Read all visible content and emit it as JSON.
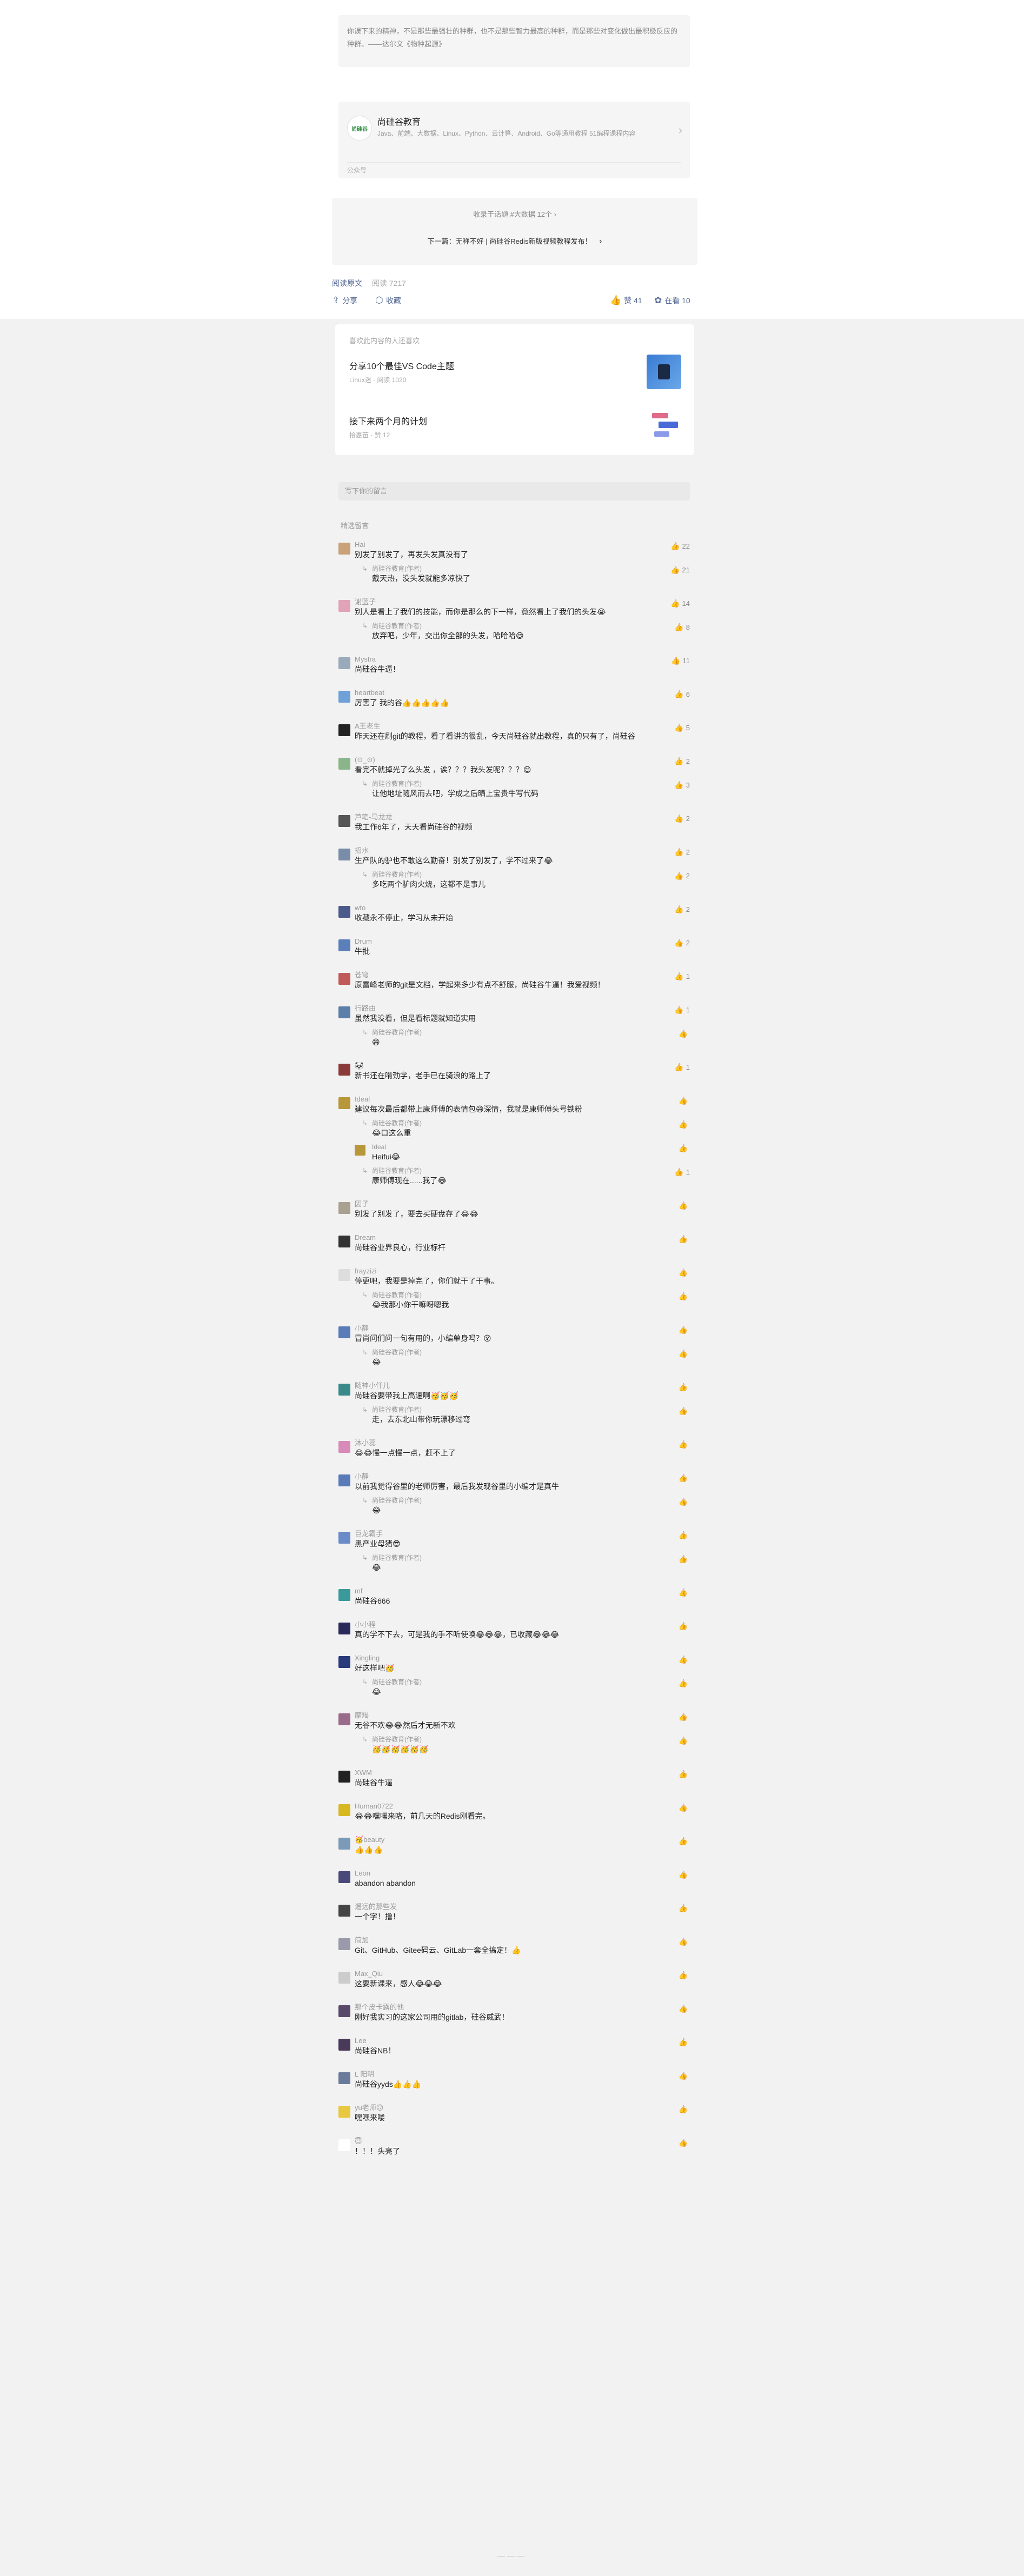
{
  "quote": "你误下来的精神，不是那些最强壮的种群，也不是那些智力最高的种群，而是那些对变化做出最积极反应的种群。——达尔文《物种起源》",
  "account": {
    "logo_text": "尚硅谷",
    "name": "尚硅谷教育",
    "desc": "Java、前端、大数据、Linux、Python、云计算、Android、Go等通用教程 51编程课程内容",
    "type": "公众号"
  },
  "album": {
    "title": "收录于话题 #大数据 12个 ›",
    "next_label": "下一篇",
    "next_title": "：无称不好 | 尚硅谷Redis新版视频教程发布！",
    "next_arrow": "›"
  },
  "meta": {
    "read_original": "阅读原文",
    "read_count": "阅读 7217"
  },
  "actions": {
    "share": "分享",
    "favorite": "收藏",
    "like": "赞 41",
    "watching": "在看 10"
  },
  "related": {
    "title": "喜欢此内容的人还喜欢",
    "items": [
      {
        "title": "分享10个最佳VS Code主题",
        "meta": "Linux迷 · 阅读 1020"
      },
      {
        "title": "接下来两个月的计划",
        "meta": "拾惠苗 · 赞 12"
      }
    ]
  },
  "write_comment": "写下你的留言",
  "featured_title": "精选留言",
  "comments": [
    {
      "name": "Hai",
      "text": "别发了别发了，再发头发真没有了",
      "likes": "22",
      "avatar": "#c9a27a",
      "replies": [
        {
          "name": "尚硅谷教育(作者)",
          "text": "戴天热，没头发就能多凉快了",
          "likes": "21"
        }
      ]
    },
    {
      "name": "谢蓝子",
      "text": "别人是看上了我们的技能，而你是那么的下一样，竟然看上了我们的头发😭",
      "likes": "14",
      "avatar": "#e0a3b8",
      "liked": true,
      "replies": [
        {
          "name": "尚硅谷教育(作者)",
          "text": "放弃吧，少年，交出你全部的头发，哈哈哈😄",
          "likes": "8"
        }
      ]
    },
    {
      "name": "Mystra",
      "text": "尚硅谷牛逼！",
      "likes": "11",
      "avatar": "#9ab",
      "replies": []
    },
    {
      "name": "heartbeat",
      "text": "厉害了 我的谷👍👍👍👍👍",
      "likes": "6",
      "avatar": "#6fa0d8",
      "replies": []
    },
    {
      "name": "A王老生",
      "text": "昨天还在刷git的教程，看了看讲的很乱，今天尚硅谷就出教程，真的只有了，尚硅谷",
      "likes": "5",
      "avatar": "#222",
      "replies": []
    },
    {
      "name": "(⊙_⊙)",
      "text": "看完不就掉光了么头发 ，诶？？？我头发呢？？？😄",
      "likes": "2",
      "avatar": "#8ab58a",
      "replies": [
        {
          "name": "尚硅谷教育(作者)",
          "text": "让他地址随风而去吧，学成之后晒上宝贵牛写代码",
          "likes": "3"
        }
      ]
    },
    {
      "name": "芦笔-马龙龙",
      "text": "我工作6年了，天天看尚硅谷的视频",
      "likes": "2",
      "avatar": "#555",
      "liked": true,
      "replies": []
    },
    {
      "name": "招水",
      "text": "生产队的驴也不敢这么勤奋！别发了别发了，学不过来了😂",
      "likes": "2",
      "avatar": "#7a8da8",
      "replies": [
        {
          "name": "尚硅谷教育(作者)",
          "text": "多吃两个驴肉火烧，这都不是事儿",
          "likes": "2"
        }
      ]
    },
    {
      "name": "wto",
      "text": "收藏永不停止，学习从未开始",
      "likes": "2",
      "avatar": "#4a5a8a",
      "replies": []
    },
    {
      "name": "Drum",
      "text": "牛批",
      "likes": "2",
      "avatar": "#5b7fb8",
      "replies": []
    },
    {
      "name": "苍穹",
      "text": "原雷峰老师的git是文档，学起来多少有点不舒服，尚硅谷牛逼！我爱视频！",
      "likes": "1",
      "avatar": "#c05a5a",
      "replies": []
    },
    {
      "name": "行路由",
      "text": "虽然我没看，但是看标题就知道实用",
      "likes": "1",
      "avatar": "#5c7ea8",
      "replies": [
        {
          "name": "尚硅谷教育(作者)",
          "text": "😄",
          "likes": ""
        }
      ]
    },
    {
      "name": "🐼",
      "text": "新书还在啃劲学，老手已在骑浪的路上了",
      "likes": "1",
      "avatar": "#8a3a3a",
      "replies": []
    },
    {
      "name": "Ideal",
      "text": "建议每次最后都带上康师傅的表情包😄深情，我就是康师傅头号铁粉",
      "likes": "",
      "avatar": "#b8963a",
      "replies": [
        {
          "name": "尚硅谷教育(作者)",
          "text": "😂口这么重",
          "likes": ""
        },
        {
          "name": "Ideal",
          "text": "Heifui😂",
          "likes": ""
        },
        {
          "name": "尚硅谷教育(作者)",
          "text": "康师傅现在......我了😂",
          "likes": "1"
        }
      ]
    },
    {
      "name": "因子",
      "text": "别发了别发了，要去买硬盘存了😂😂",
      "likes": "",
      "avatar": "#a8a090",
      "replies": []
    },
    {
      "name": "Dream",
      "text": "尚硅谷业界良心，行业标杆",
      "likes": "",
      "avatar": "#333",
      "replies": []
    },
    {
      "name": "frayzizi",
      "text": "停更吧，我要是掉完了，你们就干了干事。",
      "likes": "",
      "avatar": "#ddd",
      "replies": [
        {
          "name": "尚硅谷教育(作者)",
          "text": "😂我那小你干嘛呀嗯我",
          "likes": ""
        }
      ]
    },
    {
      "name": "小静",
      "text": "冒尚问们问一句有用的，小编单身吗？😮",
      "likes": "",
      "avatar": "#5a7bb8",
      "replies": [
        {
          "name": "尚硅谷教育(作者)",
          "text": "😂",
          "likes": ""
        }
      ]
    },
    {
      "name": "随神小仟儿",
      "text": "尚硅谷要带我上高速啊🥳🥳🥳",
      "likes": "",
      "avatar": "#3a8a8a",
      "replies": [
        {
          "name": "尚硅谷教育(作者)",
          "text": "走，去东北山带你玩漂移过弯",
          "likes": ""
        }
      ]
    },
    {
      "name": "沐小蕊",
      "text": "😂😂慢一点慢一点，赶不上了",
      "likes": "",
      "avatar": "#d88ab8",
      "replies": []
    },
    {
      "name": "小静",
      "text": "以前我觉得谷里的老师厉害，最后我发现谷里的小编才是真牛",
      "likes": "",
      "avatar": "#5a7bb8",
      "replies": [
        {
          "name": "尚硅谷教育(作者)",
          "text": "😂",
          "likes": ""
        }
      ]
    },
    {
      "name": "巨龙霸手",
      "text": "黑产业母猪😎",
      "likes": "",
      "avatar": "#6a8ac8",
      "replies": [
        {
          "name": "尚硅谷教育(作者)",
          "text": "😂",
          "likes": ""
        }
      ]
    },
    {
      "name": "mf",
      "text": "尚硅谷666",
      "likes": "",
      "avatar": "#3a9a9a",
      "replies": []
    },
    {
      "name": "小小程",
      "text": "真的学不下去，可是我的手不听使唤😂😂😂，已收藏😂😂😂",
      "likes": "",
      "avatar": "#2a2a5a",
      "replies": []
    },
    {
      "name": "Xingling",
      "text": "好这样吧🥳",
      "likes": "",
      "avatar": "#2a3a7a",
      "replies": [
        {
          "name": "尚硅谷教育(作者)",
          "text": "😂",
          "likes": ""
        }
      ]
    },
    {
      "name": "摩羯",
      "text": "无谷不欢😂😂然后才无新不欢",
      "likes": "",
      "avatar": "#9a6a8a",
      "replies": [
        {
          "name": "尚硅谷教育(作者)",
          "text": "🥳🥳🥳🥳🥳🥳",
          "likes": ""
        }
      ]
    },
    {
      "name": "XWM",
      "text": "尚硅谷牛逼",
      "likes": "",
      "avatar": "#222",
      "replies": []
    },
    {
      "name": "Human0722",
      "text": "😂😂嘿嘿来咯，前几天的Redis刚看完。",
      "likes": "",
      "avatar": "#d8b820",
      "replies": []
    },
    {
      "name": "🥳beauty",
      "text": "👍👍👍",
      "likes": "",
      "avatar": "#7a9ab8",
      "replies": []
    },
    {
      "name": "Leon",
      "text": "abandon  abandon",
      "likes": "",
      "avatar": "#4a4a7a",
      "replies": []
    },
    {
      "name": "遥远的那些发",
      "text": "一个字！撸！",
      "likes": "",
      "avatar": "#444",
      "replies": []
    },
    {
      "name": "简加",
      "text": "Git、GitHub、Gitee码云、GitLab一套全搞定！👍",
      "likes": "",
      "avatar": "#9a9aaa",
      "replies": []
    },
    {
      "name": "Max_Qiu",
      "text": "这要新课来，感人😂😂😂",
      "likes": "",
      "avatar": "#ccc",
      "replies": []
    },
    {
      "name": "那个皮卡露的他",
      "text": "刚好我实习的这家公司用的gitlab，硅谷威武！",
      "likes": "",
      "avatar": "#5a4a6a",
      "replies": []
    },
    {
      "name": "Lee",
      "text": "尚硅谷NB！",
      "likes": "",
      "avatar": "#4a3a5a",
      "replies": []
    },
    {
      "name": "L 阳明",
      "text": "尚硅谷yyds👍👍👍",
      "likes": "",
      "avatar": "#6a7a9a",
      "replies": []
    },
    {
      "name": "yu老师🙃",
      "text": "嘿嘿来喽",
      "likes": "",
      "avatar": "#e8c840",
      "replies": []
    },
    {
      "name": "😇",
      "text": "！！！头亮了",
      "likes": "",
      "avatar": "#fff",
      "replies": []
    }
  ]
}
